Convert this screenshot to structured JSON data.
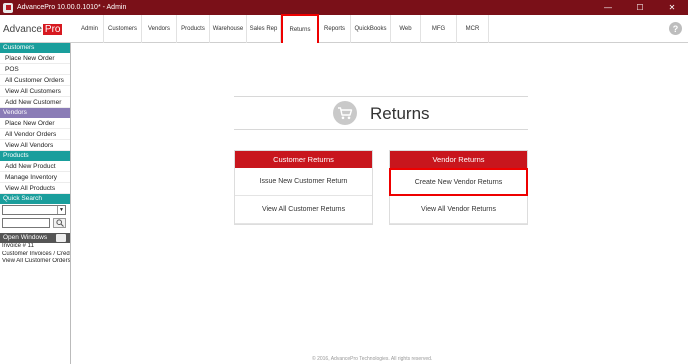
{
  "window": {
    "title": "AdvancePro 10.00.0.1010* - Admin",
    "minimize": "—",
    "maximize": "☐",
    "close": "✕"
  },
  "logo": {
    "text": "Advance",
    "highlight": "Pro"
  },
  "nav": {
    "tabs": [
      {
        "label": "Admin"
      },
      {
        "label": "Customers"
      },
      {
        "label": "Vendors"
      },
      {
        "label": "Products"
      },
      {
        "label": "Warehouse"
      },
      {
        "label": "Sales Rep"
      },
      {
        "label": "Returns",
        "active": true
      },
      {
        "label": "Reports"
      },
      {
        "label": "QuickBooks"
      },
      {
        "label": "Web"
      },
      {
        "label": "MFG"
      },
      {
        "label": "MCR"
      }
    ],
    "help": "?"
  },
  "sidebar": {
    "customers": {
      "header": "Customers",
      "items": [
        "Place New Order",
        "POS",
        "All Customer Orders",
        "View All Customers",
        "Add New Customer"
      ]
    },
    "vendors": {
      "header": "Vendors",
      "items": [
        "Place New Order",
        "All Vendor Orders",
        "View All Vendors"
      ]
    },
    "products": {
      "header": "Products",
      "items": [
        "Add New Product",
        "Manage Inventory",
        "View All Products"
      ]
    },
    "quick_search": {
      "header": "Quick Search"
    },
    "open_windows": {
      "header": "Open Windows",
      "items": [
        "Invoice # 11",
        "Customer Invoices / Credit I",
        "View All Customer Orders"
      ]
    }
  },
  "main": {
    "title": "Returns",
    "customer_returns": {
      "header": "Customer Returns",
      "links": [
        "Issue New Customer Return",
        "View All Customer Returns"
      ]
    },
    "vendor_returns": {
      "header": "Vendor Returns",
      "links": [
        "Create New Vendor Returns",
        "View All Vendor Returns"
      ]
    },
    "footer": "© 2016, AdvancePro Technologies. All rights reserved."
  },
  "colors": {
    "title_bar": "#7a1018",
    "accent_red": "#c8161d",
    "teal": "#1a9e9c",
    "purple": "#8a7cb6",
    "highlight_box": "#e00000"
  }
}
